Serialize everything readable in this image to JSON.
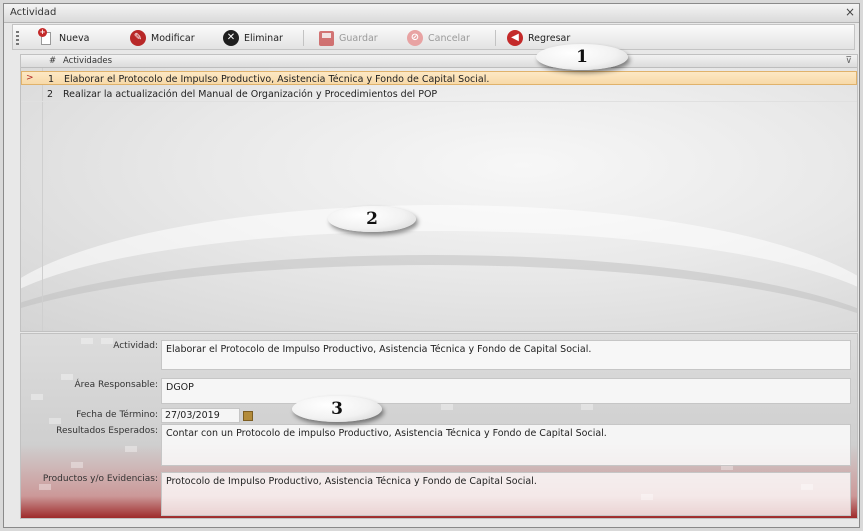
{
  "window": {
    "title": "Actividad",
    "close": "×"
  },
  "toolbar": {
    "nueva": "Nueva",
    "modificar": "Modificar",
    "eliminar": "Eliminar",
    "guardar": "Guardar",
    "cancelar": "Cancelar",
    "regresar": "Regresar"
  },
  "grid": {
    "num_header": "#",
    "column_header": "Actividades",
    "rows": [
      {
        "num": "1",
        "text": "Elaborar el Protocolo de Impulso Productivo, Asistencia Técnica y Fondo de Capital Social.",
        "selected": true
      },
      {
        "num": "2",
        "text": "Realizar la actualización del Manual de Organización y Procedimientos del POP",
        "selected": false
      }
    ],
    "current_row_marker": ">"
  },
  "form": {
    "actividad_label": "Actividad:",
    "actividad_value": "Elaborar el Protocolo de Impulso Productivo, Asistencia Técnica y Fondo de Capital Social.",
    "area_label": "Área Responsable:",
    "area_value": "DGOP",
    "fecha_label": "Fecha de Término:",
    "fecha_value": "27/03/2019",
    "resultados_label": "Resultados Esperados:",
    "resultados_value": "Contar con un Protocolo de impulso Productivo, Asistencia Técnica y Fondo de Capital Social.",
    "productos_label": "Productos y/o Evidencias:",
    "productos_value": "Protocolo de Impulso Productivo, Asistencia Técnica y Fondo de Capital Social."
  },
  "callouts": {
    "one": "1",
    "two": "2",
    "three": "3"
  },
  "colors": {
    "accent_red": "#b32a2a",
    "selected_row": "#f7d9a8"
  }
}
